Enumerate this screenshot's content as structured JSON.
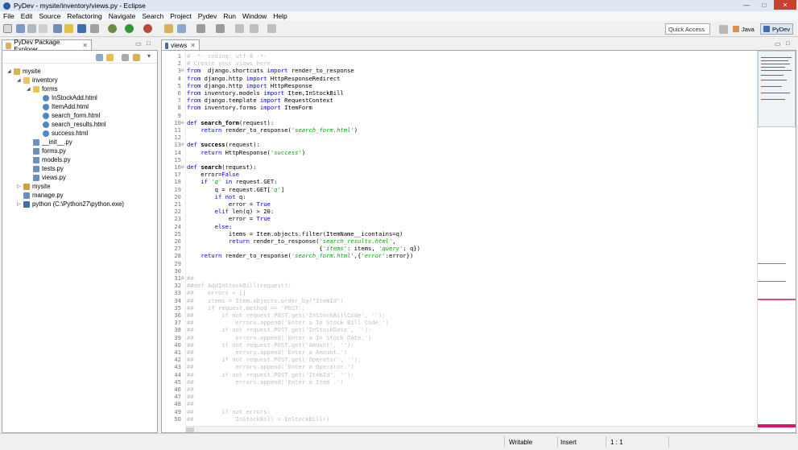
{
  "window": {
    "title": "PyDev - mysite/inventory/views.py - Eclipse"
  },
  "menu": [
    "File",
    "Edit",
    "Source",
    "Refactoring",
    "Navigate",
    "Search",
    "Project",
    "Pydev",
    "Run",
    "Window",
    "Help"
  ],
  "quick_access": {
    "placeholder": "Quick Access"
  },
  "perspectives": [
    {
      "label": "Java"
    },
    {
      "label": "PyDev"
    }
  ],
  "explorer": {
    "tab_label": "PyDev Package Explorer",
    "items": [
      {
        "label": "mysite",
        "depth": 0,
        "icon": "project-icon",
        "arrow": "down"
      },
      {
        "label": "inventory",
        "depth": 1,
        "icon": "folder-icon",
        "arrow": "down"
      },
      {
        "label": "forms",
        "depth": 2,
        "icon": "folder-icon",
        "arrow": "down"
      },
      {
        "label": "InStockAdd.html",
        "depth": 3,
        "icon": "html-file-icon",
        "arrow": ""
      },
      {
        "label": "ItemAdd.html",
        "depth": 3,
        "icon": "html-file-icon",
        "arrow": ""
      },
      {
        "label": "search_form.html",
        "depth": 3,
        "icon": "html-file-icon",
        "arrow": ""
      },
      {
        "label": "search_results.html",
        "depth": 3,
        "icon": "html-file-icon",
        "arrow": ""
      },
      {
        "label": "success.html",
        "depth": 3,
        "icon": "html-file-icon",
        "arrow": ""
      },
      {
        "label": "__init__.py",
        "depth": 2,
        "icon": "python-file-icon",
        "arrow": ""
      },
      {
        "label": "forms.py",
        "depth": 2,
        "icon": "python-file-icon",
        "arrow": ""
      },
      {
        "label": "models.py",
        "depth": 2,
        "icon": "python-file-icon",
        "arrow": ""
      },
      {
        "label": "tests.py",
        "depth": 2,
        "icon": "python-file-icon",
        "arrow": ""
      },
      {
        "label": "views.py",
        "depth": 2,
        "icon": "python-file-icon",
        "arrow": ""
      },
      {
        "label": "mysite",
        "depth": 1,
        "icon": "package-icon",
        "arrow": "right"
      },
      {
        "label": "manage.py",
        "depth": 1,
        "icon": "python-file-icon",
        "arrow": ""
      },
      {
        "label": "python  (C:\\Python27\\python.exe)",
        "depth": 1,
        "icon": "python-interpreter-icon",
        "arrow": "right"
      }
    ]
  },
  "editor": {
    "tab_label": "views",
    "lines": [
      {
        "n": "1",
        "fold": "",
        "segs": [
          [
            "cm",
            "# -*- coding: utf-8 -*-"
          ]
        ]
      },
      {
        "n": "2",
        "fold": "",
        "segs": [
          [
            "cm",
            "# Create your views here."
          ]
        ]
      },
      {
        "n": "3",
        "fold": "⊖",
        "segs": [
          [
            "kw",
            "from"
          ],
          [
            "",
            "  django.shortcuts "
          ],
          [
            "kw",
            "import"
          ],
          [
            "",
            " render_to_response"
          ]
        ]
      },
      {
        "n": "4",
        "fold": "",
        "segs": [
          [
            "kw",
            "from"
          ],
          [
            "",
            " django.http "
          ],
          [
            "kw",
            "import"
          ],
          [
            "",
            " HttpResponseRedirect"
          ]
        ]
      },
      {
        "n": "5",
        "fold": "",
        "segs": [
          [
            "kw",
            "from"
          ],
          [
            "",
            " django.http "
          ],
          [
            "kw",
            "import"
          ],
          [
            "",
            " HttpResponse"
          ]
        ]
      },
      {
        "n": "6",
        "fold": "",
        "segs": [
          [
            "kw",
            "from"
          ],
          [
            "",
            " inventory.models "
          ],
          [
            "kw",
            "import"
          ],
          [
            "",
            " Item,InStockBill"
          ]
        ]
      },
      {
        "n": "7",
        "fold": "",
        "segs": [
          [
            "kw",
            "from"
          ],
          [
            "",
            " django.template "
          ],
          [
            "kw",
            "import"
          ],
          [
            "",
            " RequestContext"
          ]
        ]
      },
      {
        "n": "8",
        "fold": "",
        "segs": [
          [
            "kw",
            "from"
          ],
          [
            "",
            " inventory.forms "
          ],
          [
            "kw",
            "import"
          ],
          [
            "",
            " ItemForm"
          ]
        ]
      },
      {
        "n": "9",
        "fold": "",
        "segs": []
      },
      {
        "n": "10",
        "fold": "⊖",
        "segs": [
          [
            "kw",
            "def"
          ],
          [
            "",
            " "
          ],
          [
            "df",
            "search_form"
          ],
          [
            "",
            "(request):"
          ]
        ]
      },
      {
        "n": "11",
        "fold": "",
        "segs": [
          [
            "",
            "    "
          ],
          [
            "kw",
            "return"
          ],
          [
            "",
            " render_to_response("
          ],
          [
            "str",
            "'search_form.html'"
          ],
          [
            "",
            ")"
          ]
        ]
      },
      {
        "n": "12",
        "fold": "",
        "segs": []
      },
      {
        "n": "13",
        "fold": "⊖",
        "segs": [
          [
            "kw",
            "def"
          ],
          [
            "",
            " "
          ],
          [
            "df",
            "success"
          ],
          [
            "",
            "(request):"
          ]
        ]
      },
      {
        "n": "14",
        "fold": "",
        "segs": [
          [
            "",
            "    "
          ],
          [
            "kw",
            "return"
          ],
          [
            "",
            " HttpResponse("
          ],
          [
            "str",
            "'success'"
          ],
          [
            "",
            ")"
          ]
        ]
      },
      {
        "n": "15",
        "fold": "",
        "segs": []
      },
      {
        "n": "16",
        "fold": "⊖",
        "segs": [
          [
            "kw",
            "def"
          ],
          [
            "",
            " "
          ],
          [
            "df",
            "search"
          ],
          [
            "",
            "(request):"
          ]
        ]
      },
      {
        "n": "17",
        "fold": "",
        "segs": [
          [
            "",
            "    error="
          ],
          [
            "kw",
            "False"
          ]
        ]
      },
      {
        "n": "18",
        "fold": "",
        "segs": [
          [
            "",
            "    "
          ],
          [
            "kw",
            "if"
          ],
          [
            "",
            " "
          ],
          [
            "str",
            "'q'"
          ],
          [
            "",
            " "
          ],
          [
            "kw",
            "in"
          ],
          [
            "",
            " request.GET:"
          ]
        ]
      },
      {
        "n": "19",
        "fold": "",
        "segs": [
          [
            "",
            "        q = request.GET["
          ],
          [
            "str",
            "'q'"
          ],
          [
            "",
            "]"
          ]
        ]
      },
      {
        "n": "20",
        "fold": "",
        "segs": [
          [
            "",
            "        "
          ],
          [
            "kw",
            "if not"
          ],
          [
            "",
            " q:"
          ]
        ]
      },
      {
        "n": "21",
        "fold": "",
        "segs": [
          [
            "",
            "            error = "
          ],
          [
            "kw",
            "True"
          ]
        ]
      },
      {
        "n": "22",
        "fold": "",
        "segs": [
          [
            "",
            "        "
          ],
          [
            "kw",
            "elif"
          ],
          [
            "",
            " len(q) > 20:"
          ]
        ]
      },
      {
        "n": "23",
        "fold": "",
        "segs": [
          [
            "",
            "            error = "
          ],
          [
            "kw",
            "True"
          ]
        ]
      },
      {
        "n": "24",
        "fold": "",
        "segs": [
          [
            "",
            "        "
          ],
          [
            "kw",
            "else"
          ],
          [
            "",
            ":"
          ]
        ]
      },
      {
        "n": "25",
        "fold": "",
        "segs": [
          [
            "",
            "            items = Item.objects.filter(ItemName__icontains=q)"
          ]
        ]
      },
      {
        "n": "26",
        "fold": "",
        "segs": [
          [
            "",
            "            "
          ],
          [
            "kw",
            "return"
          ],
          [
            "",
            " render_to_response("
          ],
          [
            "str",
            "'search_results.html'"
          ],
          [
            "",
            ","
          ]
        ]
      },
      {
        "n": "27",
        "fold": "",
        "segs": [
          [
            "",
            "                                      {"
          ],
          [
            "str",
            "'items'"
          ],
          [
            "",
            ": items, "
          ],
          [
            "str",
            "'query'"
          ],
          [
            "",
            ": q})"
          ]
        ]
      },
      {
        "n": "28",
        "fold": "",
        "segs": [
          [
            "",
            "    "
          ],
          [
            "kw",
            "return"
          ],
          [
            "",
            " render_to_response("
          ],
          [
            "str",
            "'search_form.html'"
          ],
          [
            "",
            ",{"
          ],
          [
            "str",
            "'error'"
          ],
          [
            "",
            ":error})"
          ]
        ]
      },
      {
        "n": "29",
        "fold": "",
        "segs": []
      },
      {
        "n": "30",
        "fold": "",
        "segs": []
      },
      {
        "n": "31",
        "fold": "⊖",
        "segs": [
          [
            "cm",
            "##"
          ]
        ]
      },
      {
        "n": "32",
        "fold": "",
        "segs": [
          [
            "cm",
            "##def AddInStockBill(request):"
          ]
        ]
      },
      {
        "n": "33",
        "fold": "",
        "segs": [
          [
            "cm",
            "##    errors = []"
          ]
        ]
      },
      {
        "n": "34",
        "fold": "",
        "segs": [
          [
            "cm",
            "##    items = Item.objects.order_by(\"ItemId\")"
          ]
        ]
      },
      {
        "n": "35",
        "fold": "",
        "segs": [
          [
            "cm",
            "##    if request.method == 'POST':"
          ]
        ]
      },
      {
        "n": "36",
        "fold": "",
        "segs": [
          [
            "cm",
            "##        if not request.POST.get('InStockBillCode', ''):"
          ]
        ]
      },
      {
        "n": "37",
        "fold": "",
        "segs": [
          [
            "cm",
            "##            errors.append('Enter a In Stock Bill Code.')"
          ]
        ]
      },
      {
        "n": "38",
        "fold": "",
        "segs": [
          [
            "cm",
            "##        if not request.POST.get('InStockDate', ''):"
          ]
        ]
      },
      {
        "n": "39",
        "fold": "",
        "segs": [
          [
            "cm",
            "##            errors.append('Enter a In Stock Date.')"
          ]
        ]
      },
      {
        "n": "40",
        "fold": "",
        "segs": [
          [
            "cm",
            "##        if not request.POST.get('Amount', ''):"
          ]
        ]
      },
      {
        "n": "41",
        "fold": "",
        "segs": [
          [
            "cm",
            "##            errors.append('Enter a Amount.')"
          ]
        ]
      },
      {
        "n": "42",
        "fold": "",
        "segs": [
          [
            "cm",
            "##        if not request.POST.get('Operator', ''):"
          ]
        ]
      },
      {
        "n": "43",
        "fold": "",
        "segs": [
          [
            "cm",
            "##            errors.append('Enter a Operator.')"
          ]
        ]
      },
      {
        "n": "44",
        "fold": "",
        "segs": [
          [
            "cm",
            "##        if not request.POST.get('ItemId', ''):"
          ]
        ]
      },
      {
        "n": "45",
        "fold": "",
        "segs": [
          [
            "cm",
            "##            errors.append('Enter a Item .')"
          ]
        ]
      },
      {
        "n": "46",
        "fold": "",
        "segs": [
          [
            "cm",
            "##"
          ]
        ]
      },
      {
        "n": "47",
        "fold": "",
        "segs": [
          [
            "cm",
            "##"
          ]
        ]
      },
      {
        "n": "48",
        "fold": "",
        "segs": [
          [
            "cm",
            "##"
          ]
        ]
      },
      {
        "n": "49",
        "fold": "",
        "segs": [
          [
            "cm",
            "##        if not errors:"
          ]
        ]
      },
      {
        "n": "50",
        "fold": "",
        "segs": [
          [
            "cm",
            "##            InStockBill = InStockBill()"
          ]
        ]
      }
    ]
  },
  "status": {
    "writable": "Writable",
    "insert": "Insert",
    "position": "1 : 1"
  }
}
